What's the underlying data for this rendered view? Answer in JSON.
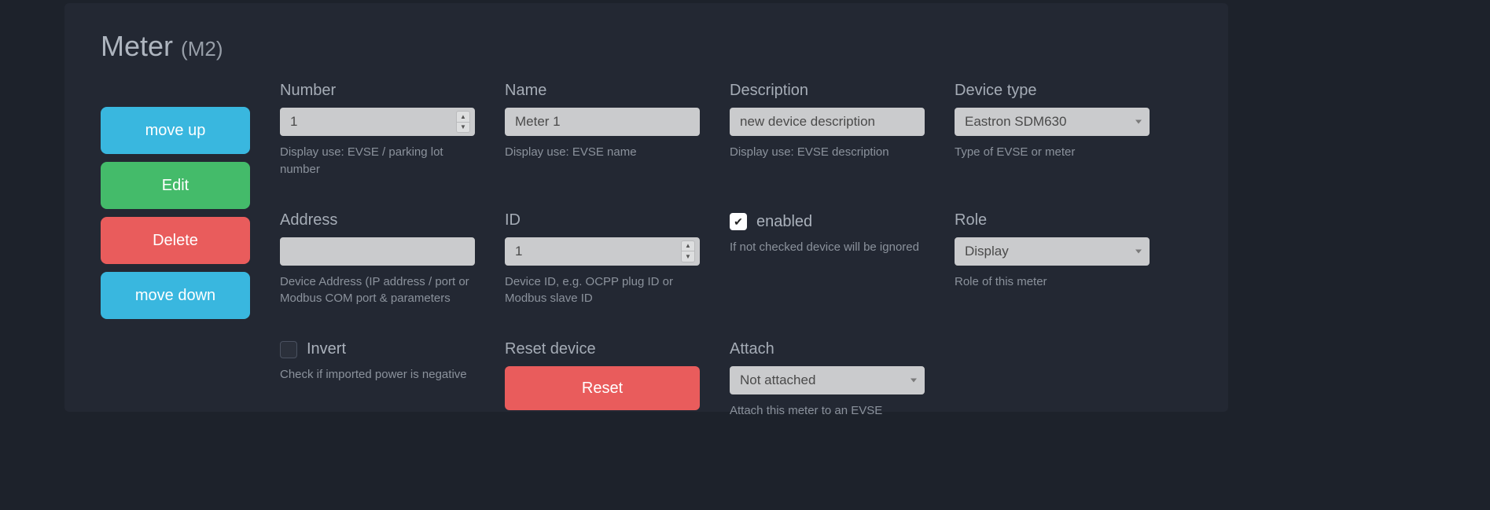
{
  "title": {
    "main": "Meter",
    "sub": "(M2)"
  },
  "sideButtons": {
    "moveUp": "move up",
    "edit": "Edit",
    "delete": "Delete",
    "moveDown": "move down"
  },
  "fields": {
    "number": {
      "label": "Number",
      "value": "1",
      "hint": "Display use: EVSE / parking lot number"
    },
    "name": {
      "label": "Name",
      "value": "Meter 1",
      "hint": "Display use: EVSE name"
    },
    "description": {
      "label": "Description",
      "value": "new device description",
      "hint": "Display use: EVSE description"
    },
    "deviceType": {
      "label": "Device type",
      "value": "Eastron SDM630",
      "hint": "Type of EVSE or meter"
    },
    "address": {
      "label": "Address",
      "value": "",
      "hint": "Device Address (IP address / port or Modbus COM port & parameters"
    },
    "id": {
      "label": "ID",
      "value": "1",
      "hint": "Device ID, e.g. OCPP plug ID or Modbus slave ID"
    },
    "enabled": {
      "label": "enabled",
      "checked": true,
      "hint": "If not checked device will be ignored"
    },
    "role": {
      "label": "Role",
      "value": "Display",
      "hint": "Role of this meter"
    },
    "invert": {
      "label": "Invert",
      "checked": false,
      "hint": "Check if imported power is negative"
    },
    "reset": {
      "label": "Reset device",
      "button": "Reset"
    },
    "attach": {
      "label": "Attach",
      "value": "Not attached",
      "hint": "Attach this meter to an EVSE"
    }
  }
}
